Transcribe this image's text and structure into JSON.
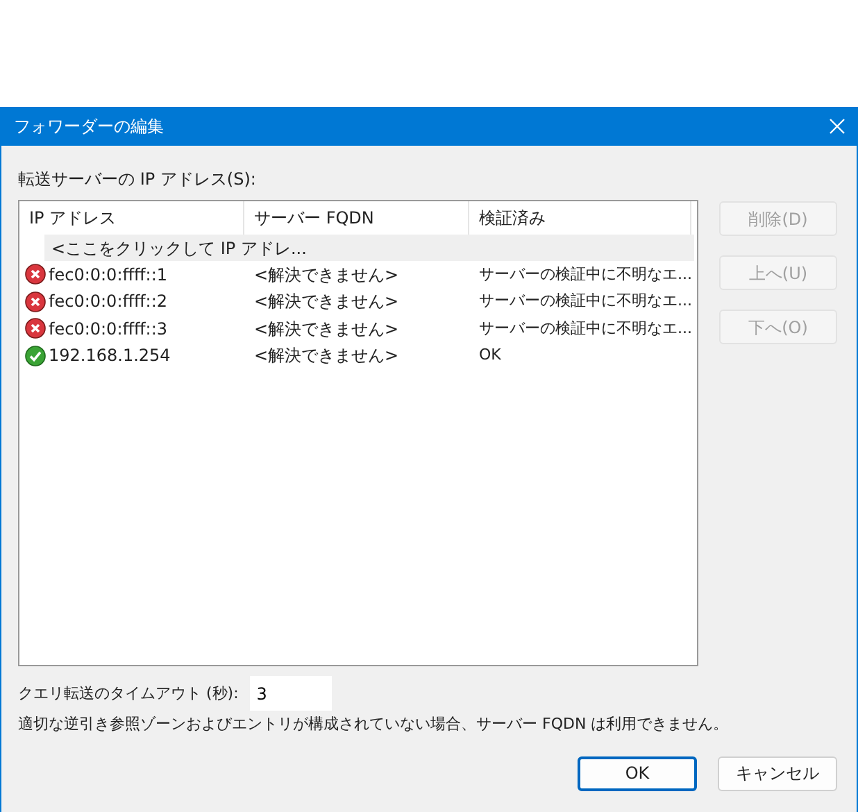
{
  "window": {
    "title": "フォワーダーの編集"
  },
  "servers_label": "転送サーバーの IP アドレス(S):",
  "table": {
    "columns": [
      "IP アドレス",
      "サーバー FQDN",
      "検証済み"
    ],
    "new_row": "<ここをクリックして IP アドレ...",
    "rows": [
      {
        "kind": "error",
        "ip": "fec0:0:0:ffff::1",
        "fqdn": "<解決できません>",
        "validated": "サーバーの検証中に不明なエ..."
      },
      {
        "kind": "error",
        "ip": "fec0:0:0:ffff::2",
        "fqdn": "<解決できません>",
        "validated": "サーバーの検証中に不明なエ..."
      },
      {
        "kind": "error",
        "ip": "fec0:0:0:ffff::3",
        "fqdn": "<解決できません>",
        "validated": "サーバーの検証中に不明なエ..."
      },
      {
        "kind": "ok",
        "ip": "192.168.1.254",
        "fqdn": "<解決できません>",
        "validated": "OK"
      }
    ]
  },
  "side_buttons": [
    {
      "label": "削除(D)",
      "disabled": true
    },
    {
      "label": "上へ(U)",
      "disabled": true
    },
    {
      "label": "下へ(O)",
      "disabled": true
    }
  ],
  "timeout": {
    "label": "クエリ転送のタイムアウト (秒):",
    "value": "3"
  },
  "note": "適切な逆引き参照ゾーンおよびエントリが構成されていない場合、サーバー FQDN は利用できません。",
  "buttons": [
    {
      "label": "OK",
      "default": true
    },
    {
      "label": "キャンセル",
      "default": false
    }
  ]
}
